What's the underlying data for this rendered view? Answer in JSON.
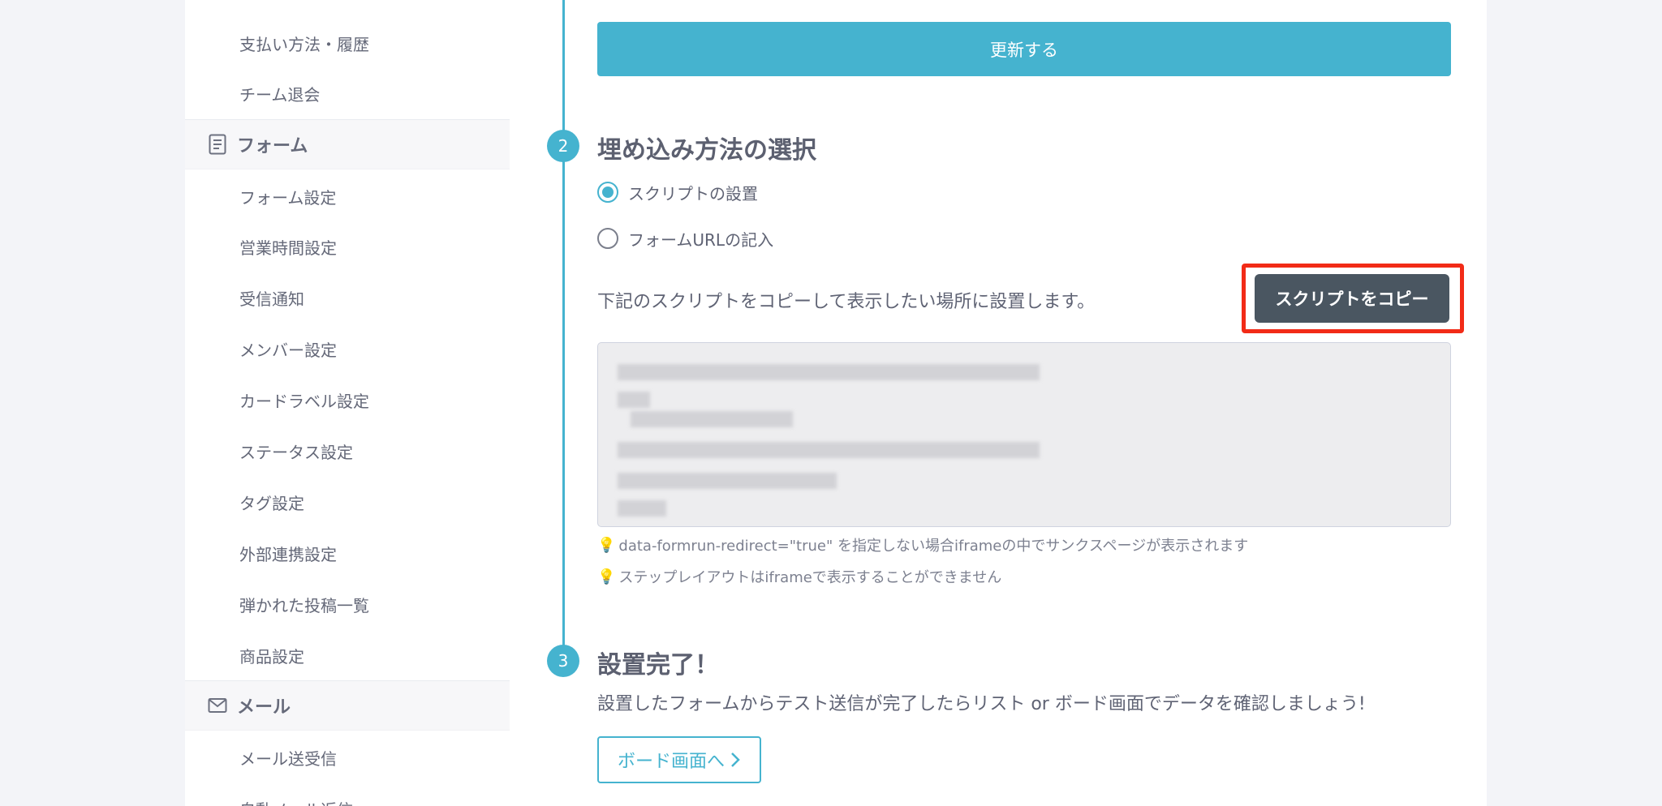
{
  "sidebar": {
    "items_top": [
      "支払い方法・履歴",
      "チーム退会"
    ],
    "section_form": {
      "label": "フォーム",
      "icon": "document-icon"
    },
    "form_items": [
      "フォーム設定",
      "営業時間設定",
      "受信通知",
      "メンバー設定",
      "カードラベル設定",
      "ステータス設定",
      "タグ設定",
      "外部連携設定",
      "弾かれた投稿一覧",
      "商品設定"
    ],
    "section_mail": {
      "label": "メール",
      "icon": "mail-icon"
    },
    "mail_items": [
      "メール送受信",
      "自動メール返信"
    ]
  },
  "main": {
    "update_button": "更新する",
    "step2": {
      "number": "2",
      "title": "埋め込み方法の選択",
      "options": [
        {
          "label": "スクリプトの設置",
          "checked": true
        },
        {
          "label": "フォームURLの記入",
          "checked": false
        }
      ],
      "description": "下記のスクリプトをコピーして表示したい場所に設置します。",
      "copy_button": "スクリプトをコピー",
      "notes": [
        "data-formrun-redirect=\"true\" を指定しない場合iframeの中でサンクスページが表示されます",
        "ステップレイアウトはiframeで表示することができません"
      ]
    },
    "step3": {
      "number": "3",
      "title": "設置完了！",
      "description": "設置したフォームからテスト送信が完了したらリスト or ボード画面でデータを確認しましょう!",
      "board_button": "ボード画面へ"
    }
  },
  "colors": {
    "accent": "#45b3cf",
    "highlight": "#f22b17",
    "copy_button": "#4a5661"
  }
}
